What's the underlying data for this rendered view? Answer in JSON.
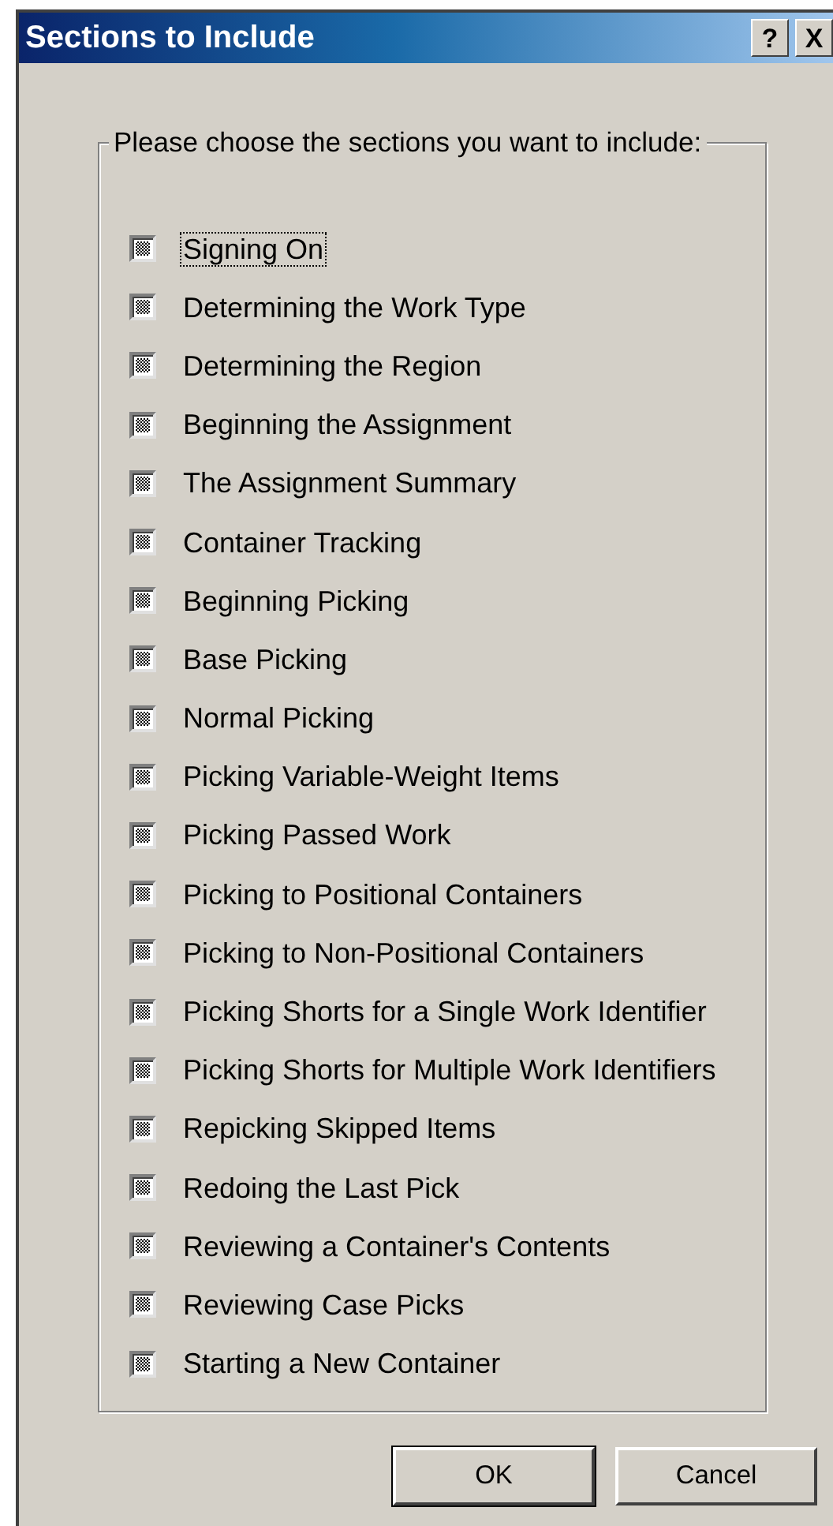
{
  "window": {
    "title": "Sections to Include",
    "title_buttons": [
      "?",
      "X"
    ]
  },
  "group": {
    "label": "Please choose the sections you want to include:"
  },
  "sections": [
    {
      "label": "Signing On",
      "checked": true,
      "indeterminate": true,
      "focused": true
    },
    {
      "label": "Determining the Work Type",
      "checked": true,
      "indeterminate": true,
      "focused": false
    },
    {
      "label": "Determining the Region",
      "checked": true,
      "indeterminate": true,
      "focused": false
    },
    {
      "label": "Beginning the Assignment",
      "checked": true,
      "indeterminate": true,
      "focused": false
    },
    {
      "label": "The Assignment Summary",
      "checked": true,
      "indeterminate": true,
      "focused": false
    },
    {
      "label": "Container Tracking",
      "checked": true,
      "indeterminate": true,
      "focused": false
    },
    {
      "label": "Beginning Picking",
      "checked": true,
      "indeterminate": true,
      "focused": false
    },
    {
      "label": "Base Picking",
      "checked": true,
      "indeterminate": true,
      "focused": false
    },
    {
      "label": "Normal Picking",
      "checked": true,
      "indeterminate": true,
      "focused": false
    },
    {
      "label": "Picking Variable-Weight Items",
      "checked": true,
      "indeterminate": true,
      "focused": false
    },
    {
      "label": "Picking Passed Work",
      "checked": true,
      "indeterminate": true,
      "focused": false
    },
    {
      "label": "Picking to Positional Containers",
      "checked": true,
      "indeterminate": true,
      "focused": false
    },
    {
      "label": "Picking to Non-Positional Containers",
      "checked": true,
      "indeterminate": true,
      "focused": false
    },
    {
      "label": "Picking Shorts for a Single Work Identifier",
      "checked": true,
      "indeterminate": true,
      "focused": false
    },
    {
      "label": "Picking Shorts for Multiple Work Identifiers",
      "checked": true,
      "indeterminate": true,
      "focused": false
    },
    {
      "label": "Repicking Skipped Items",
      "checked": true,
      "indeterminate": true,
      "focused": false
    },
    {
      "label": "Redoing the Last Pick",
      "checked": true,
      "indeterminate": true,
      "focused": false
    },
    {
      "label": "Reviewing a Container's Contents",
      "checked": true,
      "indeterminate": true,
      "focused": false
    },
    {
      "label": "Reviewing Case Picks",
      "checked": true,
      "indeterminate": true,
      "focused": false
    },
    {
      "label": "Starting a New Container",
      "checked": true,
      "indeterminate": true,
      "focused": false
    }
  ],
  "buttons": [
    {
      "label": "OK",
      "default": true
    },
    {
      "label": "Cancel",
      "default": false
    }
  ]
}
